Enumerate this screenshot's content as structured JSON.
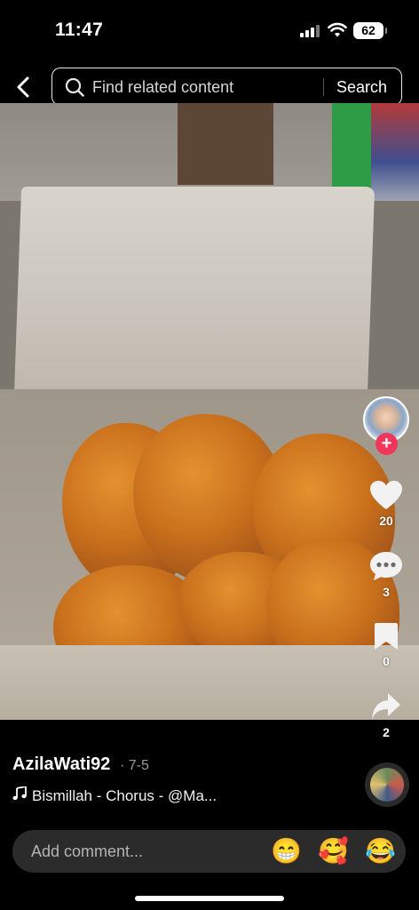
{
  "status_bar": {
    "time": "11:47",
    "battery": "62"
  },
  "search": {
    "placeholder": "Find related content",
    "button": "Search"
  },
  "actions": {
    "likes": "20",
    "comments": "3",
    "saves": "0",
    "shares": "2"
  },
  "post": {
    "username": "AzilaWati92",
    "date": "· 7-5",
    "sound": "Bismillah - Chorus - @Ma..."
  },
  "comment": {
    "placeholder": "Add comment...",
    "emojis": [
      "😁",
      "🥰",
      "😂"
    ]
  },
  "colors": {
    "follow": "#f0365a",
    "background": "#000000",
    "comment_bar": "#2b2b2b"
  }
}
